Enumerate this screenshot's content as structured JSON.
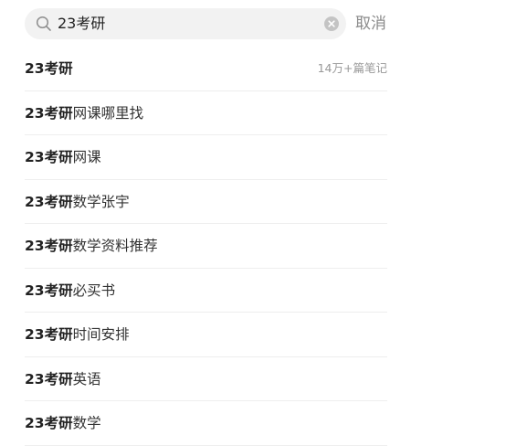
{
  "search": {
    "query": "23考研",
    "cancel_label": "取消"
  },
  "suggestions": [
    {
      "keyword": "23考研",
      "suffix": "",
      "count": "14万+篇笔记"
    },
    {
      "keyword": "23考研",
      "suffix": "网课哪里找",
      "count": ""
    },
    {
      "keyword": "23考研",
      "suffix": "网课",
      "count": ""
    },
    {
      "keyword": "23考研",
      "suffix": "数学张宇",
      "count": ""
    },
    {
      "keyword": "23考研",
      "suffix": "数学资料推荐",
      "count": ""
    },
    {
      "keyword": "23考研",
      "suffix": "必买书",
      "count": ""
    },
    {
      "keyword": "23考研",
      "suffix": "时间安排",
      "count": ""
    },
    {
      "keyword": "23考研",
      "suffix": "英语",
      "count": ""
    },
    {
      "keyword": "23考研",
      "suffix": "数学",
      "count": ""
    }
  ],
  "icons": {
    "search": "search-icon",
    "clear": "clear-icon"
  },
  "colors": {
    "search_bg": "#f2f2f2",
    "cancel_text": "#8a8a8a",
    "count_text": "#999999",
    "divider": "#eeeeee"
  }
}
